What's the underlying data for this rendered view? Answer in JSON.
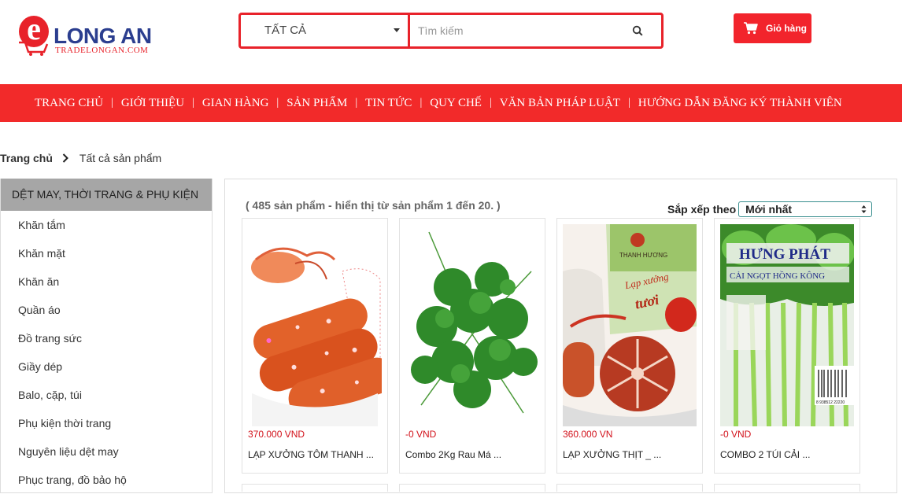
{
  "logo": {
    "letter": "e",
    "brand": "LONG AN",
    "sub": "TRADELONGAN.COM"
  },
  "search": {
    "category": "TẤT CẢ",
    "placeholder": "Tìm kiếm",
    "value": ""
  },
  "cart": {
    "label": "Giỏ hàng"
  },
  "nav": [
    "TRANG CHỦ",
    "GIỚI THIỆU",
    "GIAN HÀNG",
    "SẢN PHẨM",
    "TIN TỨC",
    "QUY CHẾ",
    "VĂN BẢN PHÁP LUẬT",
    "HƯỚNG DẪN ĐĂNG KÝ THÀNH VIÊN"
  ],
  "nav_separator": "|",
  "breadcrumb": {
    "home": "Trang chủ",
    "current": "Tất cả sản phẩm"
  },
  "sidebar": {
    "heading": "DỆT MAY, THỜI TRANG & PHỤ KIỆN",
    "items": [
      "Khăn tắm",
      "Khăn mặt",
      "Khăn ăn",
      "Quần áo",
      "Đồ trang sức",
      "Giầy dép",
      "Balo, cặp, túi",
      "Phụ kiện thời trang",
      "Nguyên liệu dệt may",
      "Phục trang, đồ bảo hộ"
    ]
  },
  "listing": {
    "count_text": "( 485 sản phẩm - hiển thị từ sản phẩm 1 đến 20. )",
    "sort_label": "Sắp xếp theo",
    "sort_value": "Mới nhất"
  },
  "products": [
    {
      "price": "370.000 VND",
      "name": "LẠP XƯỞNG TÔM THANH ...",
      "image": "sausage-shrimp"
    },
    {
      "price": "-0 VND",
      "name": "Combo 2Kg Rau Má ...",
      "image": "pennywort-greens"
    },
    {
      "price": "360.000 VN",
      "name": "LẠP XƯỞNG THỊT _ ...",
      "image": "sausage-pack"
    },
    {
      "price": "-0 VND",
      "name": "COMBO 2 TÚI CẢI ...",
      "image": "choy-sum-bag"
    }
  ],
  "package_text": {
    "brand_thanh_huong": "THANH HƯƠNG",
    "lap_xuong": "Lạp xưởng",
    "tuoi": "tươi",
    "hung_phat": "HƯNG PHÁT",
    "cai_ngot": "CẢI NGỌT HỒNG KÔNG",
    "barcode": "8 938512 22220"
  },
  "colors": {
    "brand_red": "#f22a2a",
    "price_red": "#d2111a",
    "logo_blue": "#2b3e8f"
  }
}
